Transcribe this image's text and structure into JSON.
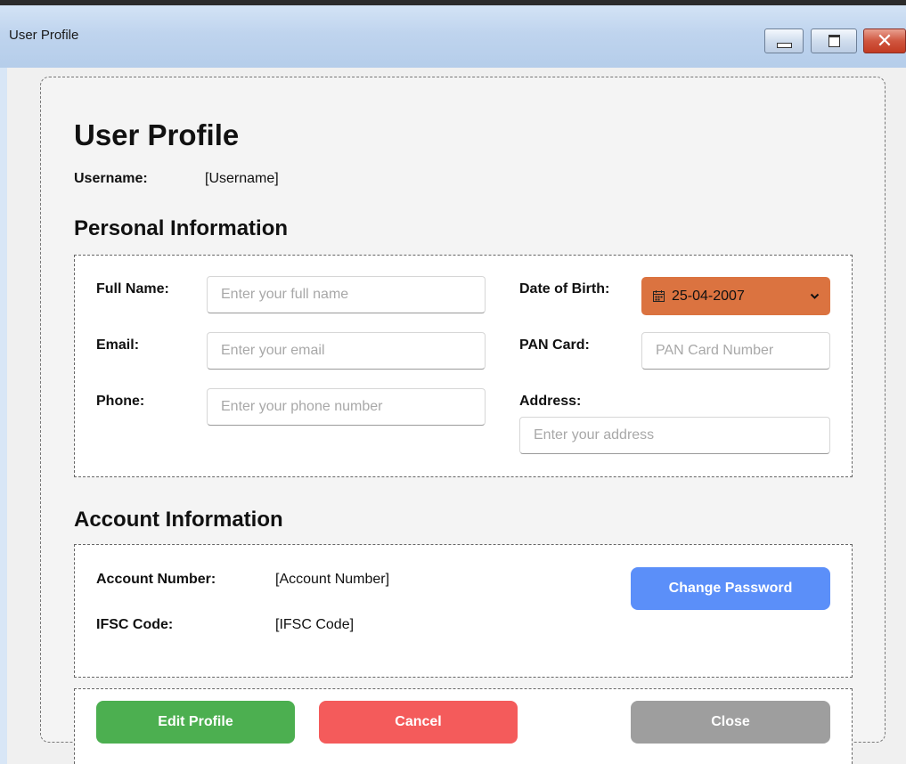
{
  "window": {
    "title": "User Profile",
    "minimize_icon": "minimize-icon",
    "maximize_icon": "maximize-icon",
    "close_icon": "close-icon",
    "close_glyph": "✕"
  },
  "page": {
    "title": "User Profile",
    "username_label": "Username:",
    "username_value": "[Username]"
  },
  "personal": {
    "section_title": "Personal Information",
    "full_name": {
      "label": "Full Name:",
      "placeholder": "Enter your full name",
      "value": ""
    },
    "email": {
      "label": "Email:",
      "placeholder": "Enter your email",
      "value": ""
    },
    "phone": {
      "label": "Phone:",
      "placeholder": "Enter your phone number",
      "value": ""
    },
    "dob": {
      "label": "Date of Birth:",
      "value": "25-04-2007",
      "icon": "calendar-icon",
      "dropdown_icon": "chevron-down-icon",
      "color": "#db7340"
    },
    "pan": {
      "label": "PAN Card:",
      "placeholder": "PAN Card Number",
      "value": ""
    },
    "address": {
      "label": "Address:",
      "placeholder": "Enter your address",
      "value": ""
    }
  },
  "account": {
    "section_title": "Account Information",
    "account_number_label": "Account Number:",
    "account_number_value": "[Account Number]",
    "ifsc_label": "IFSC Code:",
    "ifsc_value": "[IFSC Code]",
    "change_password_label": "Change Password"
  },
  "actions": {
    "edit_label": "Edit Profile",
    "cancel_label": "Cancel",
    "close_label": "Close"
  },
  "colors": {
    "change_password": "#5b8ff9",
    "edit": "#4caf50",
    "cancel": "#f45b5b",
    "close": "#9e9e9e"
  }
}
